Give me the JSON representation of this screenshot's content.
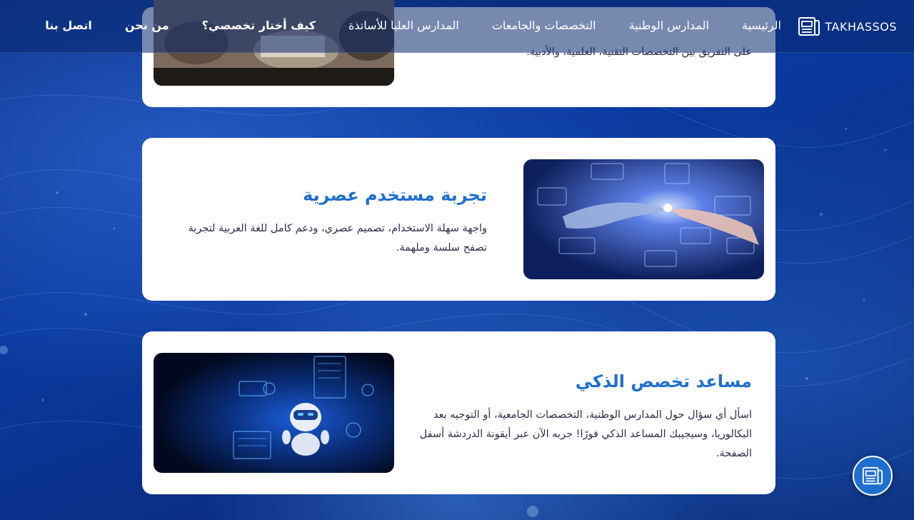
{
  "nav": {
    "brand": "TAKHASSOS",
    "links": [
      {
        "label": "الرئيسية"
      },
      {
        "label": "المدارس الوطنية"
      },
      {
        "label": "التخصصات والجامعات"
      },
      {
        "label": "المدارس العليا للأساتذة"
      },
      {
        "label": "كيف أختار تخصصي؟"
      },
      {
        "label": "من نحن"
      },
      {
        "label": "اتصل بنا"
      }
    ]
  },
  "cards": [
    {
      "desc": "على التفريق بين التخصصات التقنية، العلمية، والأدبية."
    },
    {
      "title": "تجربة مستخدم عصرية",
      "desc": "واجهة سهلة الاستخدام، تصميم عصري، ودعم كامل للغة العربية لتجربة تصفح سلسة وملهمة."
    },
    {
      "title": "مساعد تخصص الذكي",
      "desc": "اسأل أي سؤال حول المدارس الوطنية، التخصصات الجامعية، أو التوجيه بعد البكالوريا، وسيجيبك المساعد الذكي فورًا! جربه الآن عبر أيقونة الدردشة أسفل الصفحة."
    }
  ],
  "icons": {
    "brand_logo": "newspaper-icon",
    "chat": "newspaper-icon"
  },
  "colors": {
    "accent": "#1f6fd0",
    "background": "#0b2f86",
    "card": "#ffffff"
  }
}
